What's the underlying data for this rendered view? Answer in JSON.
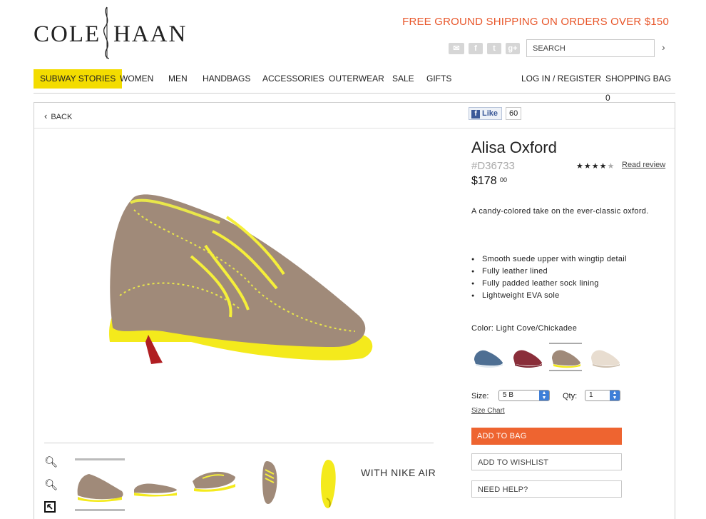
{
  "header": {
    "logo_left": "COLE",
    "logo_right": "HAAN",
    "promo": "FREE GROUND SHIPPING ON ORDERS OVER $150",
    "search_placeholder": "SEARCH",
    "social_icons": [
      "mail-icon",
      "facebook-icon",
      "twitter-icon",
      "google-plus-icon"
    ]
  },
  "nav": {
    "items": [
      "SUBWAY STORIES",
      "WOMEN",
      "MEN",
      "HANDBAGS",
      "ACCESSORIES",
      "OUTERWEAR",
      "SALE",
      "GIFTS"
    ],
    "login": "LOG IN / REGISTER",
    "bag": "SHOPPING BAG 0",
    "active_color": "#f3dc00"
  },
  "page": {
    "back": "BACK",
    "like_label": "Like",
    "like_count": "60"
  },
  "product": {
    "title": "Alisa Oxford",
    "sku": "#D36733",
    "price_dollars": "$178",
    "price_cents": "00",
    "rating": 4,
    "rating_max": 5,
    "read_review": "Read review",
    "description": "A candy-colored take on the ever-classic oxford.",
    "features": [
      "Smooth suede upper with wingtip detail",
      "Fully leather lined",
      "Fully padded leather sock lining",
      "Lightweight EVA sole"
    ],
    "color_label": "Color:",
    "color_value": "Light Cove/Chickadee",
    "swatches": [
      "blue",
      "burgundy",
      "light-cove-chickadee",
      "cream"
    ],
    "size_label": "Size:",
    "size_value": "5 B",
    "qty_label": "Qty:",
    "qty_value": "1",
    "size_chart": "Size Chart",
    "add_to_bag": "ADD TO BAG",
    "add_to_wishlist": "ADD TO WISHLIST",
    "need_help": "NEED HELP?",
    "nike": "WITH NIKE AIR",
    "accent_color": "#ee6430",
    "promo_color": "#e8562a"
  }
}
